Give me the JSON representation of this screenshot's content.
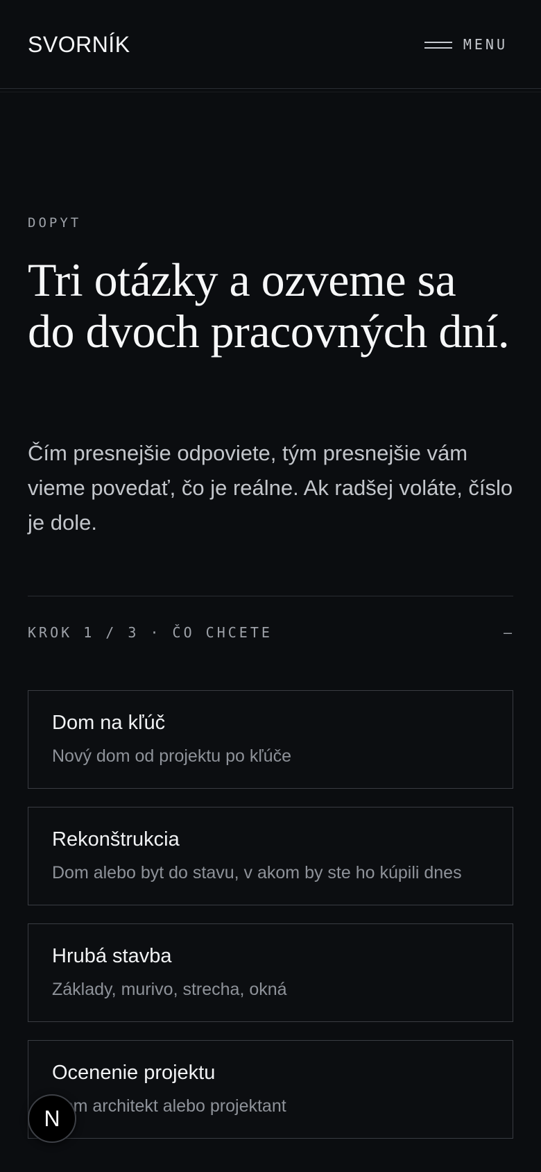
{
  "header": {
    "brand": "SVORNÍK",
    "menu_label": "MENU",
    "menu_icon": "hamburger-icon"
  },
  "hero": {
    "kicker": "DOPYT",
    "headline": "Tri otázky a ozveme sa do dvoch pracovných dní.",
    "intro": "Čím presnejšie odpoviete, tým presnejšie vám vieme povedať, čo je reálne. Ak radšej voláte, číslo je dole."
  },
  "form": {
    "step_label": "KROK 1 / 3 · ČO CHCETE",
    "toggle_symbol": "—",
    "options": [
      {
        "title": "Dom na kľúč",
        "description": "Nový dom od projektu po kľúče"
      },
      {
        "title": "Rekonštrukcia",
        "description": "Dom alebo byt do stavu, v akom by ste ho kúpili dnes"
      },
      {
        "title": "Hrubá stavba",
        "description": "Základy, murivo, strecha, okná"
      },
      {
        "title": "Ocenenie projektu",
        "description": "Som architekt alebo projektant"
      }
    ]
  },
  "badge": {
    "letter": "N"
  },
  "colors": {
    "background": "#0b0d10",
    "text": "#f1f2f4",
    "muted": "#8e9299",
    "border": "#3a3d43"
  }
}
